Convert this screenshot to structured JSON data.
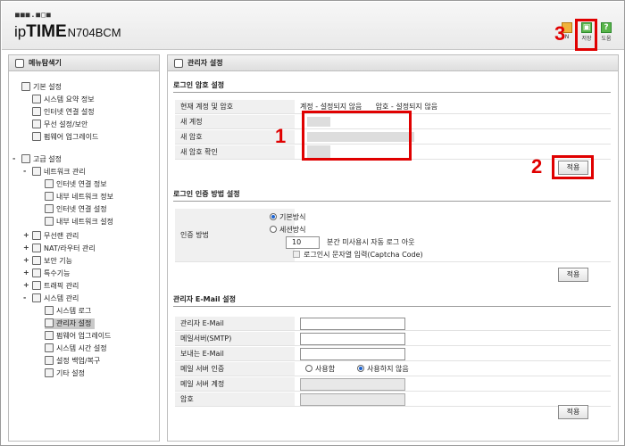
{
  "header": {
    "logo_dots": "■■■.■□■",
    "logo_ip": "ip",
    "logo_time": "TIME",
    "logo_model": "N704BCM",
    "tools": [
      {
        "label": "N"
      },
      {
        "label": "저장"
      },
      {
        "label": "도움"
      }
    ]
  },
  "sidebar": {
    "title": "메뉴탐색기",
    "basic": {
      "label": "기본 설정",
      "items": [
        "시스템 요약 정보",
        "인터넷 연결 설정",
        "무선 설정/보안",
        "펌웨어 업그레이드"
      ]
    },
    "advanced": {
      "label": "고급 설정"
    },
    "network": {
      "label": "네트워크 관리",
      "items": [
        "인터넷 연결 정보",
        "내부 네트워크 정보",
        "인터넷 연결 설정",
        "내부 네트워크 설정"
      ]
    },
    "groups": [
      "무선랜 관리",
      "NAT/라우터 관리",
      "보안 기능",
      "특수기능",
      "트래픽 관리"
    ],
    "system": {
      "label": "시스템 관리",
      "items": [
        "시스템 로그",
        "관리자 설정",
        "펌웨어 업그레이드",
        "시스템 시간 설정",
        "설정 백업/복구",
        "기타 설정"
      ]
    },
    "expand_symbol": "+",
    "collapse_symbol": "-"
  },
  "main": {
    "title": "관리자 설정",
    "login_section": {
      "title": "로그인 암호 설정",
      "current_label": "현재 계정 및 암호",
      "current_value": "계정 - 설정되지 않음      암호 - 설정되지 않음",
      "new_account_label": "새 계정",
      "new_password_label": "새 암호",
      "confirm_label": "새 암호 확인",
      "apply": "적용"
    },
    "auth_section": {
      "title": "로그인 인증 방법 설정",
      "method_label": "인증 방법",
      "option_basic": "기본방식",
      "option_session": "세션방식",
      "timeout_value": "10",
      "timeout_text": "분간 미사용시 자동 로그 아웃",
      "captcha_text": "로그인시 문자열 입력(Captcha Code)",
      "apply": "적용"
    },
    "email_section": {
      "title": "관리자 E-Mail 설정",
      "email_label": "관리자 E-Mail",
      "smtp_label": "메일서버(SMTP)",
      "sender_label": "보내는 E-Mail",
      "auth_label": "메일 서버 인증",
      "auth_use": "사용함",
      "auth_nouse": "사용하지 않음",
      "account_label": "메일 서버 계정",
      "password_label": "암호",
      "apply": "적용"
    }
  },
  "callouts": [
    "1",
    "2",
    "3"
  ],
  "colors": {
    "callout_red": "#e00000",
    "selected_menu": "#c9c9c9"
  }
}
